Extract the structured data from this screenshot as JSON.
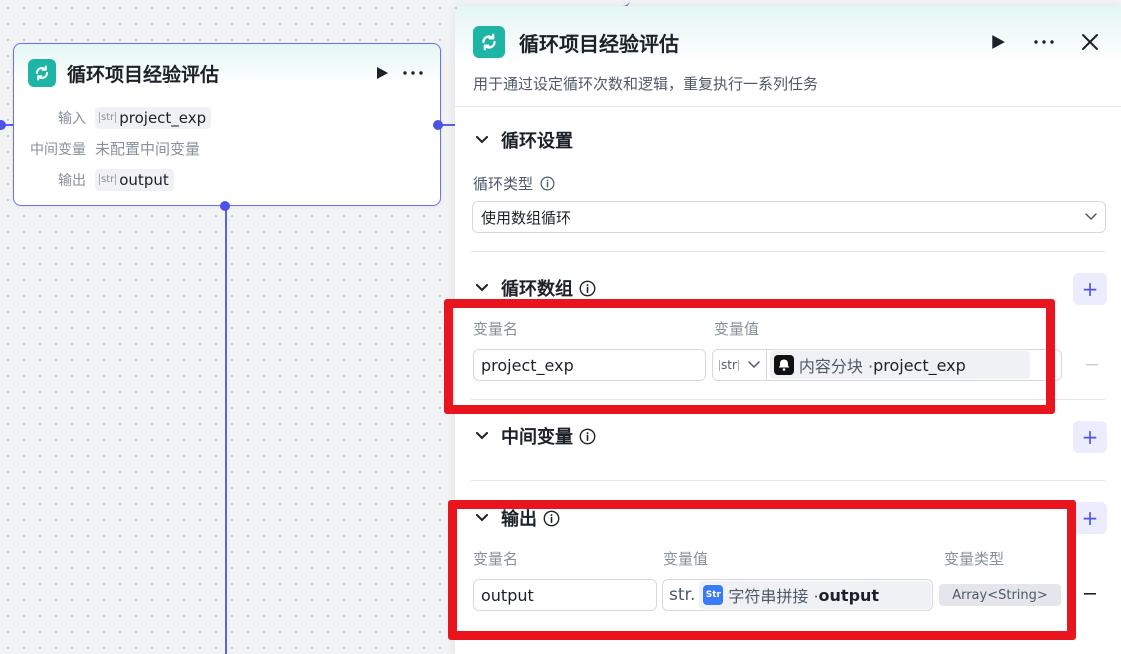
{
  "node": {
    "title": "循环项目经验评估",
    "input_label": "输入",
    "input_value": "project_exp",
    "intermediate_label": "中间变量",
    "intermediate_value": "未配置中间变量",
    "output_label": "输出",
    "output_value": "output",
    "str_tag": "str"
  },
  "panel": {
    "title": "循环项目经验评估",
    "description": "用于通过设定循环次数和逻辑，重复执行一系列任务",
    "loop_settings": {
      "title": "循环设置",
      "type_label": "循环类型",
      "type_value": "使用数组循环"
    },
    "loop_array": {
      "title": "循环数组",
      "col_name": "变量名",
      "col_value": "变量值",
      "var_name": "project_exp",
      "type_tag": "str",
      "ref_source": "内容分块 · ",
      "ref_var": "project_exp"
    },
    "intermediate": {
      "title": "中间变量"
    },
    "output": {
      "title": "输出",
      "col_name": "变量名",
      "col_value": "变量值",
      "col_type": "变量类型",
      "var_name": "output",
      "type_prefix": "str.",
      "ref_source": "字符串拼接 · ",
      "ref_var": "output",
      "var_type": "Array<String>"
    }
  },
  "colors": {
    "accent": "#4d53e8",
    "icon_teal": "#1fb5a6",
    "highlight_red": "#e8141e",
    "str_icon_blue": "#3b7cf6"
  }
}
